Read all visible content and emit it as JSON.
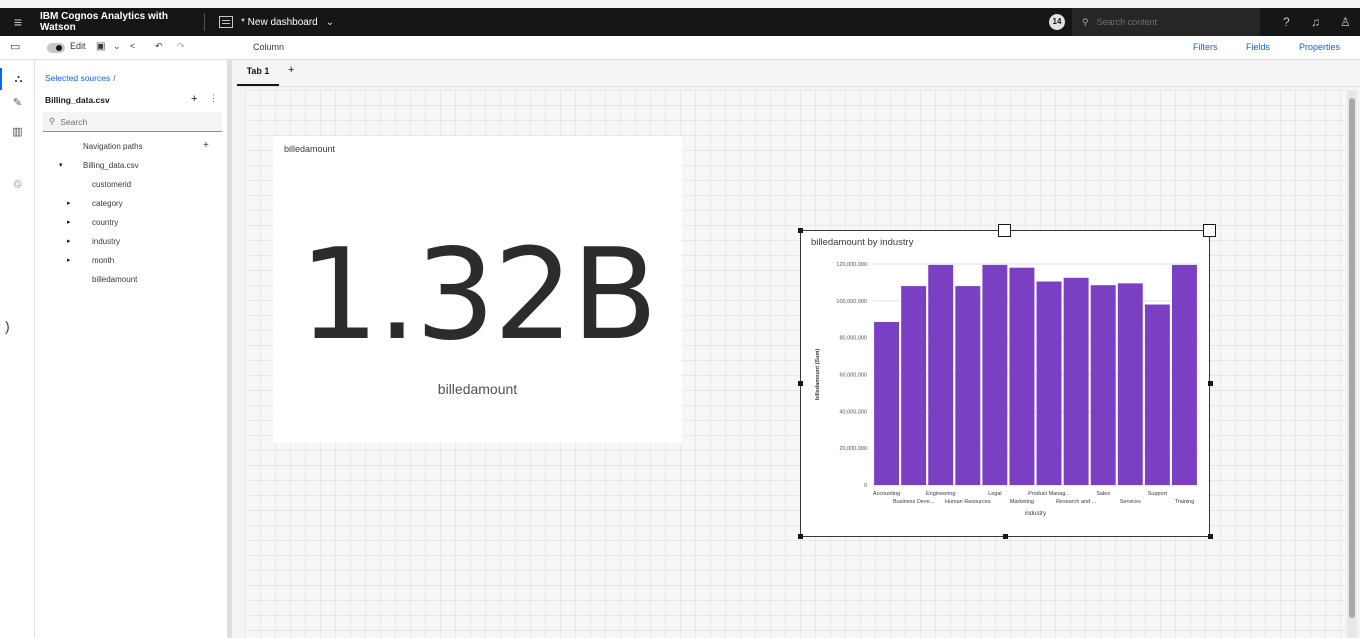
{
  "topbar": {
    "menu_icon": "hamburger-icon",
    "app_title": "IBM Cognos Analytics with Watson",
    "dashboard_title": "* New dashboard",
    "notification_count": "14",
    "search_placeholder": "Search content"
  },
  "toolbar": {
    "edit_label": "Edit",
    "widget_type": "Column",
    "filters_label": "Filters",
    "fields_label": "Fields",
    "properties_label": "Properties"
  },
  "panel": {
    "breadcrumb": "Selected sources",
    "breadcrumb_sep": "/",
    "source_name": "Billing_data.csv",
    "search_placeholder": "Search",
    "tree": [
      {
        "label": "Navigation paths",
        "caret": "",
        "add": "+"
      },
      {
        "label": "Billing_data.csv",
        "caret": "▾",
        "add": ""
      },
      {
        "label": "customerid",
        "caret": "",
        "add": ""
      },
      {
        "label": "category",
        "caret": "▸",
        "add": ""
      },
      {
        "label": "country",
        "caret": "▸",
        "add": ""
      },
      {
        "label": "industry",
        "caret": "▸",
        "add": ""
      },
      {
        "label": "month",
        "caret": "▸",
        "add": ""
      },
      {
        "label": "billedamount",
        "caret": "",
        "add": ""
      }
    ]
  },
  "tabs": {
    "tab1": "Tab 1",
    "add": "+"
  },
  "kpi": {
    "title": "billedamount",
    "value": "1.32B",
    "label": "billedamount"
  },
  "chart_data": {
    "type": "bar",
    "title": "billedamount by industry",
    "xlabel": "industry",
    "ylabel": "billedamount (Sum)",
    "ylim": [
      0,
      120000000
    ],
    "yticks": [
      "0",
      "20,000,000",
      "40,000,000",
      "60,000,000",
      "80,000,000",
      "100,000,000",
      "120,000,000"
    ],
    "categories": [
      "Accounting",
      "Business Deve...",
      "Engineering",
      "Human Resources",
      "Legal",
      "Marketing",
      "Product Manag...",
      "Research and ...",
      "Sales",
      "Services",
      "Support",
      "Training"
    ],
    "values": [
      88500000,
      108000000,
      119500000,
      108000000,
      119500000,
      118000000,
      110500000,
      112500000,
      108500000,
      109500000,
      98000000,
      119500000
    ],
    "bar_color": "#7b3fc4"
  },
  "colors": {
    "accent": "#0f62fe",
    "topbar": "#161616",
    "bar": "#7b3fc4"
  }
}
